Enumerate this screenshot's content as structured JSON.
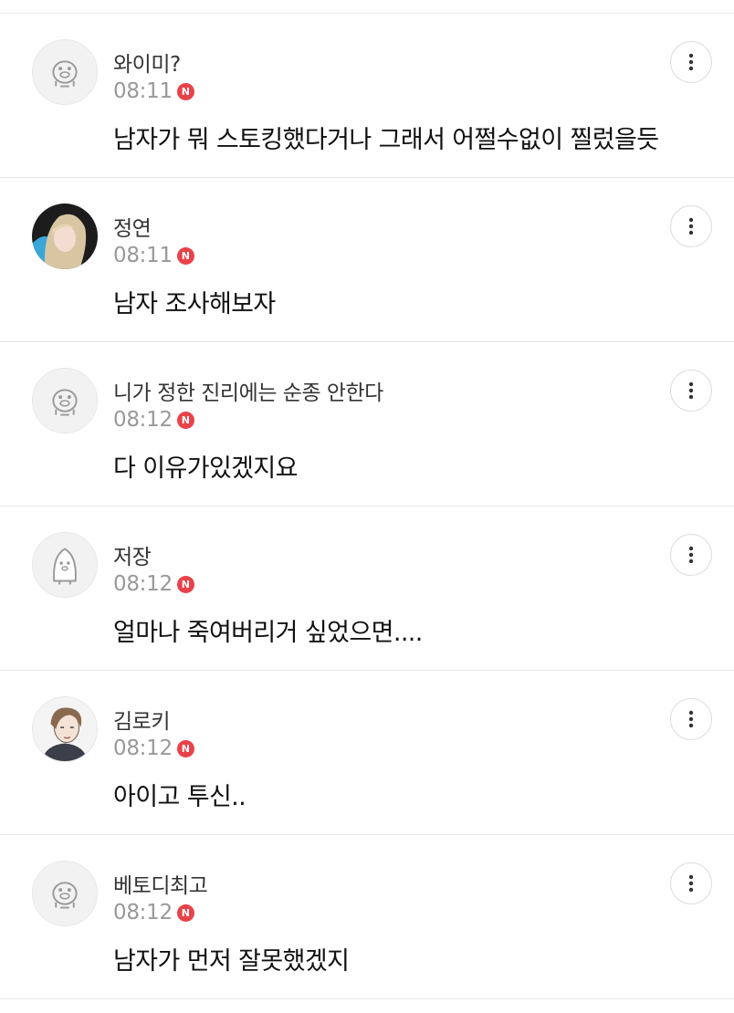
{
  "comments": [
    {
      "nickname": "와이미?",
      "time": "08:11",
      "badge": "N",
      "text": "남자가 뭐 스토킹했다거나 그래서 어쩔수없이 찔렀을듯",
      "avatar": "default-character-icon"
    },
    {
      "nickname": "정연",
      "time": "08:11",
      "badge": "N",
      "text": "남자 조사해보자",
      "avatar": "profile-photo"
    },
    {
      "nickname": "니가 정한 진리에는 순종 안한다",
      "time": "08:12",
      "badge": "N",
      "text": "다 이유가있겠지요",
      "avatar": "default-character-icon"
    },
    {
      "nickname": "저장",
      "time": "08:12",
      "badge": "N",
      "text": "얼마나 죽여버리거 싶었으면....",
      "avatar": "penguin-character-icon"
    },
    {
      "nickname": "김로키",
      "time": "08:12",
      "badge": "N",
      "text": "아이고 투신..",
      "avatar": "illustrated-profile-image"
    },
    {
      "nickname": "베토디최고",
      "time": "08:12",
      "badge": "N",
      "text": "남자가 먼저 잘못했겠지",
      "avatar": "default-character-icon"
    }
  ],
  "colors": {
    "badge": "#e8424a",
    "divider": "#e6e6e6",
    "time": "#999999",
    "nickname": "#333333",
    "text": "#111111"
  },
  "icons": {
    "more": "vertical-dots-icon"
  }
}
